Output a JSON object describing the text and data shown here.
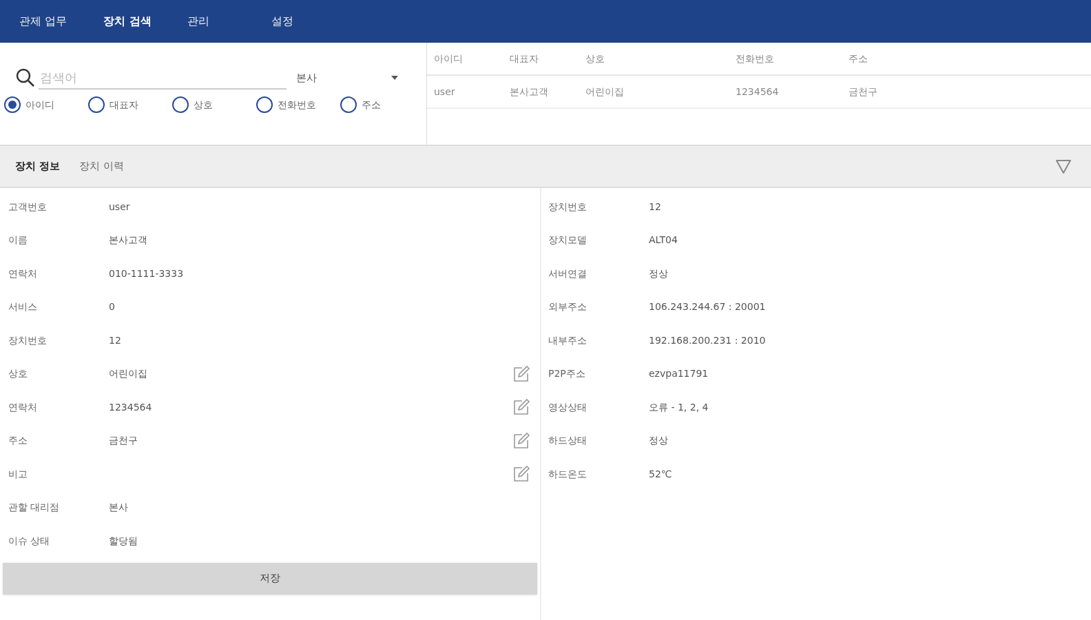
{
  "nav": [
    {
      "label": "관제 업무",
      "selected": false
    },
    {
      "label": "장치 검색",
      "selected": true
    },
    {
      "label": "관리",
      "selected": false
    },
    {
      "label": "설정",
      "selected": false
    }
  ],
  "search": {
    "placeholder": "검색어",
    "branch": "본사",
    "options": [
      {
        "label": "아이디",
        "selected": true
      },
      {
        "label": "대표자",
        "selected": false
      },
      {
        "label": "상호",
        "selected": false
      },
      {
        "label": "전화번호",
        "selected": false
      },
      {
        "label": "주소",
        "selected": false
      }
    ]
  },
  "table": {
    "columns": [
      "아이디",
      "대표자",
      "상호",
      "전화번호",
      "주소"
    ],
    "rows": [
      [
        "user",
        "본사고객",
        "어린이집",
        "1234564",
        "금천구"
      ]
    ]
  },
  "tabs": [
    {
      "label": "장치 정보",
      "selected": true
    },
    {
      "label": "장치 이력",
      "selected": false
    }
  ],
  "customer_fields": [
    {
      "label": "고객번호",
      "value": "user",
      "editable": false
    },
    {
      "label": "이름",
      "value": "본사고객",
      "editable": false
    },
    {
      "label": "연락처",
      "value": "010-1111-3333",
      "editable": false
    },
    {
      "label": "서비스",
      "value": "0",
      "editable": false
    },
    {
      "label": "장치번호",
      "value": "12",
      "editable": false
    },
    {
      "label": "상호",
      "value": "어린이집",
      "editable": true
    },
    {
      "label": "연락처",
      "value": "1234564",
      "editable": true
    },
    {
      "label": "주소",
      "value": "금천구",
      "editable": true
    },
    {
      "label": "비고",
      "editable": true
    },
    {
      "label": "관할 대리점",
      "value": "본사",
      "editable": false
    },
    {
      "label": "이슈 상태",
      "value": "할당됨",
      "editable": false
    }
  ],
  "save_button": "저장",
  "device_fields": [
    {
      "label": "장치번호",
      "value": "12"
    },
    {
      "label": "장치모델",
      "value": "ALT04"
    },
    {
      "label": "서버연결",
      "value": "정상"
    },
    {
      "label": "외부주소",
      "value": "106.243.244.67 : 20001"
    },
    {
      "label": "내부주소",
      "value": "192.168.200.231 : 2010"
    },
    {
      "label": "P2P주소",
      "value": "ezvpa11791"
    },
    {
      "label": "영상상태",
      "value": "오류 - 1, 2, 4"
    },
    {
      "label": "하드상태",
      "value": "정상"
    },
    {
      "label": "하드온도",
      "value": "52℃"
    }
  ]
}
